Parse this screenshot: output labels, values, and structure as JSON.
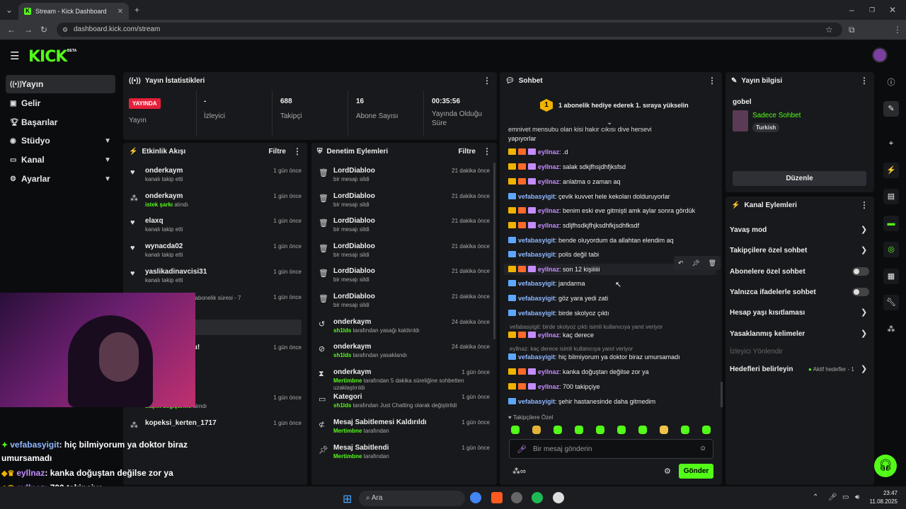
{
  "browser": {
    "tab_title": "Stream - Kick Dashboard",
    "url": "dashboard.kick.com/stream"
  },
  "header": {
    "logo": "KICK",
    "logo_badge": "BETA"
  },
  "sidebar": {
    "items": [
      {
        "label": "Yayın",
        "icon": "broadcast-icon"
      },
      {
        "label": "Gelir",
        "icon": "wallet-icon"
      },
      {
        "label": "Başarılar",
        "icon": "trophy-icon"
      },
      {
        "label": "Stüdyo",
        "icon": "studio-icon"
      },
      {
        "label": "Kanal",
        "icon": "channel-icon"
      },
      {
        "label": "Ayarlar",
        "icon": "gear-icon"
      }
    ]
  },
  "stats": {
    "title": "Yayın İstatistikleri",
    "live_badge": "YAYINDA",
    "live_label": "Yayın",
    "viewers_value": "-",
    "viewers_label": "İzleyici",
    "followers_value": "688",
    "followers_label": "Takipçi",
    "subs_value": "16",
    "subs_label": "Abone Sayısı",
    "uptime_value": "00:35:56",
    "uptime_label": "Yayında Olduğu Süre"
  },
  "activity": {
    "title": "Etkinlik Akışı",
    "filter": "Filtre",
    "items": [
      {
        "name": "onderkaym",
        "sub": "kanalı takip etti",
        "time": "1 gün önce"
      },
      {
        "name": "onderkaym",
        "sub_green": "istek şarkı",
        "sub": " alındı",
        "time": "1 gün önce"
      },
      {
        "name": "elaxq",
        "sub": "kanalı takip etti",
        "time": "1 gün önce"
      },
      {
        "name": "wynacda02",
        "sub": "kanalı takip etti",
        "time": "1 gün önce"
      },
      {
        "name": "yaslikadinavcisi31",
        "sub": "kanalı takip etti",
        "time": "1 gün önce"
      },
      {
        "name": "",
        "sub": "ini kutluyor! Toplam abonelik süresi - 7",
        "time": "1 gün önce"
      },
      {
        "name": "",
        "sub": "",
        "time": "1 gün önce"
      },
      {
        "name": "den abone oldu!",
        "sub": "lar",
        "time": "1 gün önce"
      },
      {
        "name": "",
        "sub": "kanalı takip etti",
        "time": ""
      },
      {
        "name": "ardadmrkrn",
        "sub_green": "başlık değiştirme",
        "sub": " alındı",
        "time": "1 gün önce"
      },
      {
        "name": "kopeksi_kerten_1717",
        "sub": "",
        "time": "1 gün önce"
      }
    ]
  },
  "moderation": {
    "title": "Denetim Eylemleri",
    "filter": "Filtre",
    "items": [
      {
        "name": "LordDiabloo",
        "sub": "bir mesajı sildi",
        "time": "21 dakika önce"
      },
      {
        "name": "LordDiabloo",
        "sub": "bir mesajı sildi",
        "time": "21 dakika önce"
      },
      {
        "name": "LordDiabloo",
        "sub": "bir mesajı sildi",
        "time": "21 dakika önce"
      },
      {
        "name": "LordDiabloo",
        "sub": "bir mesajı sildi",
        "time": "21 dakika önce"
      },
      {
        "name": "LordDiabloo",
        "sub": "bir mesajı sildi",
        "time": "21 dakika önce"
      },
      {
        "name": "LordDiabloo",
        "sub": "bir mesajı sildi",
        "time": "21 dakika önce"
      },
      {
        "name": "onderkaym",
        "sub_green": "sh1lds",
        "sub": " tarafından yasağı kaldırıldı",
        "time": "24 dakika önce"
      },
      {
        "name": "onderkaym",
        "sub_green": "sh1lds",
        "sub": " tarafından yasaklandı",
        "time": "24 dakika önce"
      },
      {
        "name": "onderkaym",
        "sub_green": "Mertimbne",
        "sub": " tarafından 5 dakika süreliğine sohbetten uzaklaştırıldı",
        "time": "1 gün önce"
      },
      {
        "name": "Kategori",
        "sub_green": "sh1lds",
        "sub": " tarafından Just Chatting olarak değiştirildi",
        "time": "1 gün önce"
      },
      {
        "name": "Mesaj Sabitlemesi Kaldırıldı",
        "sub_green": "Mertimbne",
        "sub": " tarafından",
        "time": "1 gün önce"
      },
      {
        "name": "Mesaj Sabitlendi",
        "sub_green": "Mertimbne",
        "sub": " tarafından",
        "time": "1 gün önce"
      }
    ]
  },
  "chat": {
    "title": "Sohbet",
    "gift_banner": "1 abonelik hediye ederek 1. sıraya yükselin",
    "gift_rank": "1",
    "top_cut": "emniyet mensubu olan kişi hakır çıkışı diye herşeyi",
    "top_cut2": "yapıyorlar",
    "messages": [
      {
        "user": "eyllnaz",
        "c": "p",
        "text": ": .d"
      },
      {
        "user": "eyllnaz",
        "c": "p",
        "text": ": salak sdkjfhsjdhfjksfsd"
      },
      {
        "user": "eyllnaz",
        "c": "p",
        "text": ": anlatma o zaman aq"
      },
      {
        "user": "vefabasyigit",
        "c": "b",
        "text": ": çevik kuvvet hele kekoları dolduruyorlar"
      },
      {
        "user": "eyllnaz",
        "c": "p",
        "text": ": benim eski eve gitmişti amk aylar sonra gördük"
      },
      {
        "user": "eyllnaz",
        "c": "p",
        "text": ": sdljfhsdkjfhjksdhfkjsdhfksdf"
      },
      {
        "user": "vefabasyigit",
        "c": "b",
        "text": ": bende oluyordum da allahtan elendim aq"
      },
      {
        "user": "vefabasyigit",
        "c": "b",
        "text": ": polis değil tabi"
      },
      {
        "user": "eyllnaz",
        "c": "p",
        "text": ": son 12 kişiiiiii"
      },
      {
        "user": "vefabasyigit",
        "c": "b",
        "text": ": jandarma"
      },
      {
        "user": "vefabasyigit",
        "c": "b",
        "text": ": göz yara yedi zati"
      },
      {
        "user": "vefabasyigit",
        "c": "b",
        "text": ": birde skolyoz çıktı"
      },
      {
        "user": "eyllnaz",
        "c": "p",
        "text": ": kaç derece"
      },
      {
        "user": "vefabasyigit",
        "c": "b",
        "text": ": hiç bilmiyorum ya doktor biraz umursamadı"
      },
      {
        "user": "eyllnaz",
        "c": "p",
        "text": ": kanka doğuştan değilse zor ya"
      },
      {
        "user": "eyllnaz",
        "c": "p",
        "text": ": 700 takipçiye"
      },
      {
        "user": "vefabasyigit",
        "c": "b",
        "text": ": şehir hastanesinde daha gitmedim"
      }
    ],
    "reply1": "vefabasyigit: birde skolyoz çıktı isimli kullanıcıya yanıt veriyor",
    "reply2": "eyllnaz: kaç derece isimli kullanıcıya yanıt veriyor",
    "followers_only": "Takipçilere Özel",
    "input_placeholder": "Bir mesaj gönderin",
    "send": "Gönder"
  },
  "stream_info": {
    "title": "Yayın bilgisi",
    "name": "gobel",
    "category": "Sadece Sohbet",
    "tag": "Turkish",
    "edit": "Düzenle"
  },
  "channel_actions": {
    "title": "Kanal Eylemleri",
    "slow": "Yavaş mod",
    "followers": "Takipçilere özel sohbet",
    "subs": "Abonelere özel sohbet",
    "emotes": "Yalnızca ifadelerle sohbet",
    "age": "Hesap yaşı kısıtlaması",
    "banned": "Yasaklanmış kelimeler",
    "viewer_guide": "İzleyici Yönlendir",
    "goals": "Hedefleri belirleyin",
    "goals_status": "Aktif hedefler - 1"
  },
  "overlay": [
    {
      "user": "vefabasyigit",
      "text": ": hiç bilmiyorum ya doktor biraz"
    },
    {
      "user": "",
      "text": "umursamadı"
    },
    {
      "user": "eyllnaz",
      "text": ": kanka doğuştan değilse zor ya"
    },
    {
      "user": "eyllnaz",
      "text": ": 700 takipçiye"
    },
    {
      "user": "vefabasyigit",
      "text": ": şehir hastanesinde daha gitmedim"
    }
  ],
  "taskbar": {
    "search": "Ara",
    "time": "23:47",
    "date": "11.08.2025"
  },
  "colors": {
    "accent": "#53fc18",
    "panel": "#18191c",
    "bg": "#0b0c0e"
  }
}
